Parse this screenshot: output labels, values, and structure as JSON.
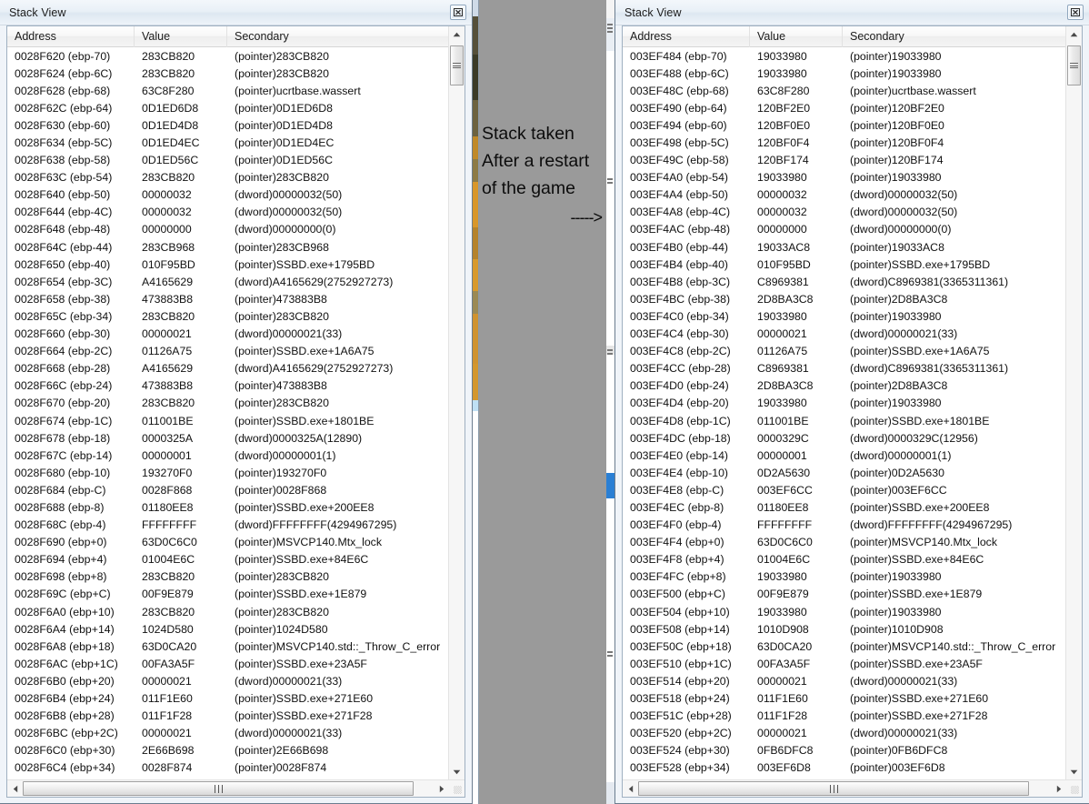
{
  "annotation": {
    "line1": "Stack taken",
    "line2": "After a restart",
    "line3": "of the game",
    "arrow": "----->"
  },
  "columns": {
    "address": "Address",
    "value": "Value",
    "secondary": "Secondary"
  },
  "left_window": {
    "title": "Stack View",
    "close_icon": "close-icon",
    "rows": [
      {
        "address": "0028F620 (ebp-70)",
        "value": "283CB820",
        "secondary": "(pointer)283CB820"
      },
      {
        "address": "0028F624 (ebp-6C)",
        "value": "283CB820",
        "secondary": "(pointer)283CB820"
      },
      {
        "address": "0028F628 (ebp-68)",
        "value": "63C8F280",
        "secondary": "(pointer)ucrtbase.wassert"
      },
      {
        "address": "0028F62C (ebp-64)",
        "value": "0D1ED6D8",
        "secondary": "(pointer)0D1ED6D8"
      },
      {
        "address": "0028F630 (ebp-60)",
        "value": "0D1ED4D8",
        "secondary": "(pointer)0D1ED4D8"
      },
      {
        "address": "0028F634 (ebp-5C)",
        "value": "0D1ED4EC",
        "secondary": "(pointer)0D1ED4EC"
      },
      {
        "address": "0028F638 (ebp-58)",
        "value": "0D1ED56C",
        "secondary": "(pointer)0D1ED56C"
      },
      {
        "address": "0028F63C (ebp-54)",
        "value": "283CB820",
        "secondary": "(pointer)283CB820"
      },
      {
        "address": "0028F640 (ebp-50)",
        "value": "00000032",
        "secondary": "(dword)00000032(50)"
      },
      {
        "address": "0028F644 (ebp-4C)",
        "value": "00000032",
        "secondary": "(dword)00000032(50)"
      },
      {
        "address": "0028F648 (ebp-48)",
        "value": "00000000",
        "secondary": "(dword)00000000(0)"
      },
      {
        "address": "0028F64C (ebp-44)",
        "value": "283CB968",
        "secondary": "(pointer)283CB968"
      },
      {
        "address": "0028F650 (ebp-40)",
        "value": "010F95BD",
        "secondary": "(pointer)SSBD.exe+1795BD"
      },
      {
        "address": "0028F654 (ebp-3C)",
        "value": "A4165629",
        "secondary": "(dword)A4165629(2752927273)"
      },
      {
        "address": "0028F658 (ebp-38)",
        "value": "473883B8",
        "secondary": "(pointer)473883B8"
      },
      {
        "address": "0028F65C (ebp-34)",
        "value": "283CB820",
        "secondary": "(pointer)283CB820"
      },
      {
        "address": "0028F660 (ebp-30)",
        "value": "00000021",
        "secondary": "(dword)00000021(33)"
      },
      {
        "address": "0028F664 (ebp-2C)",
        "value": "01126A75",
        "secondary": "(pointer)SSBD.exe+1A6A75"
      },
      {
        "address": "0028F668 (ebp-28)",
        "value": "A4165629",
        "secondary": "(dword)A4165629(2752927273)"
      },
      {
        "address": "0028F66C (ebp-24)",
        "value": "473883B8",
        "secondary": "(pointer)473883B8"
      },
      {
        "address": "0028F670 (ebp-20)",
        "value": "283CB820",
        "secondary": "(pointer)283CB820"
      },
      {
        "address": "0028F674 (ebp-1C)",
        "value": "011001BE",
        "secondary": "(pointer)SSBD.exe+1801BE"
      },
      {
        "address": "0028F678 (ebp-18)",
        "value": "0000325A",
        "secondary": "(dword)0000325A(12890)"
      },
      {
        "address": "0028F67C (ebp-14)",
        "value": "00000001",
        "secondary": "(dword)00000001(1)"
      },
      {
        "address": "0028F680 (ebp-10)",
        "value": "193270F0",
        "secondary": "(pointer)193270F0"
      },
      {
        "address": "0028F684 (ebp-C)",
        "value": "0028F868",
        "secondary": "(pointer)0028F868"
      },
      {
        "address": "0028F688 (ebp-8)",
        "value": "01180EE8",
        "secondary": "(pointer)SSBD.exe+200EE8"
      },
      {
        "address": "0028F68C (ebp-4)",
        "value": "FFFFFFFF",
        "secondary": "(dword)FFFFFFFF(4294967295)"
      },
      {
        "address": "0028F690 (ebp+0)",
        "value": "63D0C6C0",
        "secondary": "(pointer)MSVCP140.Mtx_lock"
      },
      {
        "address": "0028F694 (ebp+4)",
        "value": "01004E6C",
        "secondary": "(pointer)SSBD.exe+84E6C"
      },
      {
        "address": "0028F698 (ebp+8)",
        "value": "283CB820",
        "secondary": "(pointer)283CB820"
      },
      {
        "address": "0028F69C (ebp+C)",
        "value": "00F9E879",
        "secondary": "(pointer)SSBD.exe+1E879"
      },
      {
        "address": "0028F6A0 (ebp+10)",
        "value": "283CB820",
        "secondary": "(pointer)283CB820"
      },
      {
        "address": "0028F6A4 (ebp+14)",
        "value": "1024D580",
        "secondary": "(pointer)1024D580"
      },
      {
        "address": "0028F6A8 (ebp+18)",
        "value": "63D0CA20",
        "secondary": "(pointer)MSVCP140.std::_Throw_C_error"
      },
      {
        "address": "0028F6AC (ebp+1C)",
        "value": "00FA3A5F",
        "secondary": "(pointer)SSBD.exe+23A5F"
      },
      {
        "address": "0028F6B0 (ebp+20)",
        "value": "00000021",
        "secondary": "(dword)00000021(33)"
      },
      {
        "address": "0028F6B4 (ebp+24)",
        "value": "011F1E60",
        "secondary": "(pointer)SSBD.exe+271E60"
      },
      {
        "address": "0028F6B8 (ebp+28)",
        "value": "011F1F28",
        "secondary": "(pointer)SSBD.exe+271F28"
      },
      {
        "address": "0028F6BC (ebp+2C)",
        "value": "00000021",
        "secondary": "(dword)00000021(33)"
      },
      {
        "address": "0028F6C0 (ebp+30)",
        "value": "2E66B698",
        "secondary": "(pointer)2E66B698"
      },
      {
        "address": "0028F6C4 (ebp+34)",
        "value": "0028F874",
        "secondary": "(pointer)0028F874"
      }
    ]
  },
  "right_window": {
    "title": "Stack View",
    "close_icon": "close-icon",
    "rows": [
      {
        "address": "003EF484 (ebp-70)",
        "value": "19033980",
        "secondary": "(pointer)19033980"
      },
      {
        "address": "003EF488 (ebp-6C)",
        "value": "19033980",
        "secondary": "(pointer)19033980"
      },
      {
        "address": "003EF48C (ebp-68)",
        "value": "63C8F280",
        "secondary": "(pointer)ucrtbase.wassert"
      },
      {
        "address": "003EF490 (ebp-64)",
        "value": "120BF2E0",
        "secondary": "(pointer)120BF2E0"
      },
      {
        "address": "003EF494 (ebp-60)",
        "value": "120BF0E0",
        "secondary": "(pointer)120BF0E0"
      },
      {
        "address": "003EF498 (ebp-5C)",
        "value": "120BF0F4",
        "secondary": "(pointer)120BF0F4"
      },
      {
        "address": "003EF49C (ebp-58)",
        "value": "120BF174",
        "secondary": "(pointer)120BF174"
      },
      {
        "address": "003EF4A0 (ebp-54)",
        "value": "19033980",
        "secondary": "(pointer)19033980"
      },
      {
        "address": "003EF4A4 (ebp-50)",
        "value": "00000032",
        "secondary": "(dword)00000032(50)"
      },
      {
        "address": "003EF4A8 (ebp-4C)",
        "value": "00000032",
        "secondary": "(dword)00000032(50)"
      },
      {
        "address": "003EF4AC (ebp-48)",
        "value": "00000000",
        "secondary": "(dword)00000000(0)"
      },
      {
        "address": "003EF4B0 (ebp-44)",
        "value": "19033AC8",
        "secondary": "(pointer)19033AC8"
      },
      {
        "address": "003EF4B4 (ebp-40)",
        "value": "010F95BD",
        "secondary": "(pointer)SSBD.exe+1795BD"
      },
      {
        "address": "003EF4B8 (ebp-3C)",
        "value": "C8969381",
        "secondary": "(dword)C8969381(3365311361)"
      },
      {
        "address": "003EF4BC (ebp-38)",
        "value": "2D8BA3C8",
        "secondary": "(pointer)2D8BA3C8"
      },
      {
        "address": "003EF4C0 (ebp-34)",
        "value": "19033980",
        "secondary": "(pointer)19033980"
      },
      {
        "address": "003EF4C4 (ebp-30)",
        "value": "00000021",
        "secondary": "(dword)00000021(33)"
      },
      {
        "address": "003EF4C8 (ebp-2C)",
        "value": "01126A75",
        "secondary": "(pointer)SSBD.exe+1A6A75"
      },
      {
        "address": "003EF4CC (ebp-28)",
        "value": "C8969381",
        "secondary": "(dword)C8969381(3365311361)"
      },
      {
        "address": "003EF4D0 (ebp-24)",
        "value": "2D8BA3C8",
        "secondary": "(pointer)2D8BA3C8"
      },
      {
        "address": "003EF4D4 (ebp-20)",
        "value": "19033980",
        "secondary": "(pointer)19033980"
      },
      {
        "address": "003EF4D8 (ebp-1C)",
        "value": "011001BE",
        "secondary": "(pointer)SSBD.exe+1801BE"
      },
      {
        "address": "003EF4DC (ebp-18)",
        "value": "0000329C",
        "secondary": "(dword)0000329C(12956)"
      },
      {
        "address": "003EF4E0 (ebp-14)",
        "value": "00000001",
        "secondary": "(dword)00000001(1)"
      },
      {
        "address": "003EF4E4 (ebp-10)",
        "value": "0D2A5630",
        "secondary": "(pointer)0D2A5630"
      },
      {
        "address": "003EF4E8 (ebp-C)",
        "value": "003EF6CC",
        "secondary": "(pointer)003EF6CC"
      },
      {
        "address": "003EF4EC (ebp-8)",
        "value": "01180EE8",
        "secondary": "(pointer)SSBD.exe+200EE8"
      },
      {
        "address": "003EF4F0 (ebp-4)",
        "value": "FFFFFFFF",
        "secondary": "(dword)FFFFFFFF(4294967295)"
      },
      {
        "address": "003EF4F4 (ebp+0)",
        "value": "63D0C6C0",
        "secondary": "(pointer)MSVCP140.Mtx_lock"
      },
      {
        "address": "003EF4F8 (ebp+4)",
        "value": "01004E6C",
        "secondary": "(pointer)SSBD.exe+84E6C"
      },
      {
        "address": "003EF4FC (ebp+8)",
        "value": "19033980",
        "secondary": "(pointer)19033980"
      },
      {
        "address": "003EF500 (ebp+C)",
        "value": "00F9E879",
        "secondary": "(pointer)SSBD.exe+1E879"
      },
      {
        "address": "003EF504 (ebp+10)",
        "value": "19033980",
        "secondary": "(pointer)19033980"
      },
      {
        "address": "003EF508 (ebp+14)",
        "value": "1010D908",
        "secondary": "(pointer)1010D908"
      },
      {
        "address": "003EF50C (ebp+18)",
        "value": "63D0CA20",
        "secondary": "(pointer)MSVCP140.std::_Throw_C_error"
      },
      {
        "address": "003EF510 (ebp+1C)",
        "value": "00FA3A5F",
        "secondary": "(pointer)SSBD.exe+23A5F"
      },
      {
        "address": "003EF514 (ebp+20)",
        "value": "00000021",
        "secondary": "(dword)00000021(33)"
      },
      {
        "address": "003EF518 (ebp+24)",
        "value": "011F1E60",
        "secondary": "(pointer)SSBD.exe+271E60"
      },
      {
        "address": "003EF51C (ebp+28)",
        "value": "011F1F28",
        "secondary": "(pointer)SSBD.exe+271F28"
      },
      {
        "address": "003EF520 (ebp+2C)",
        "value": "00000021",
        "secondary": "(dword)00000021(33)"
      },
      {
        "address": "003EF524 (ebp+30)",
        "value": "0FB6DFC8",
        "secondary": "(pointer)0FB6DFC8"
      },
      {
        "address": "003EF528 (ebp+34)",
        "value": "003EF6D8",
        "secondary": "(pointer)003EF6D8"
      }
    ]
  },
  "colors": {
    "desktop_background": "#9a9a9a",
    "window_frame": "#f0f4f9",
    "grid_background": "#ffffff",
    "text": "#111111"
  }
}
